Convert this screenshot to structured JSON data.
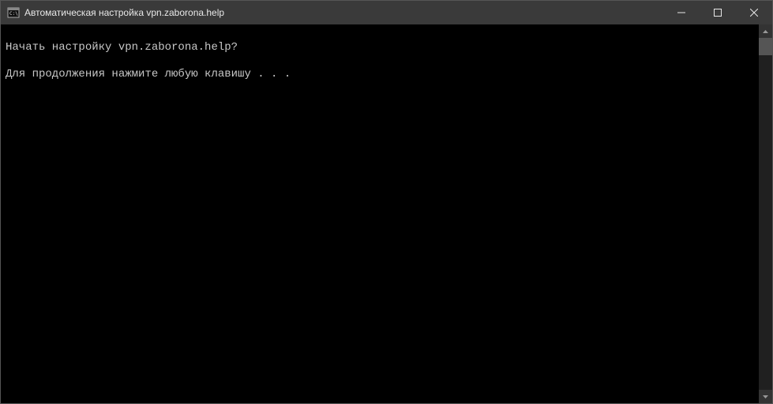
{
  "titlebar": {
    "title": "Автоматическая настройка vpn.zaborona.help"
  },
  "console": {
    "line1": "",
    "line2": "Начать настройку vpn.zaborona.help?",
    "line3": "",
    "line4": "Для продолжения нажмите любую клавишу . . ."
  }
}
